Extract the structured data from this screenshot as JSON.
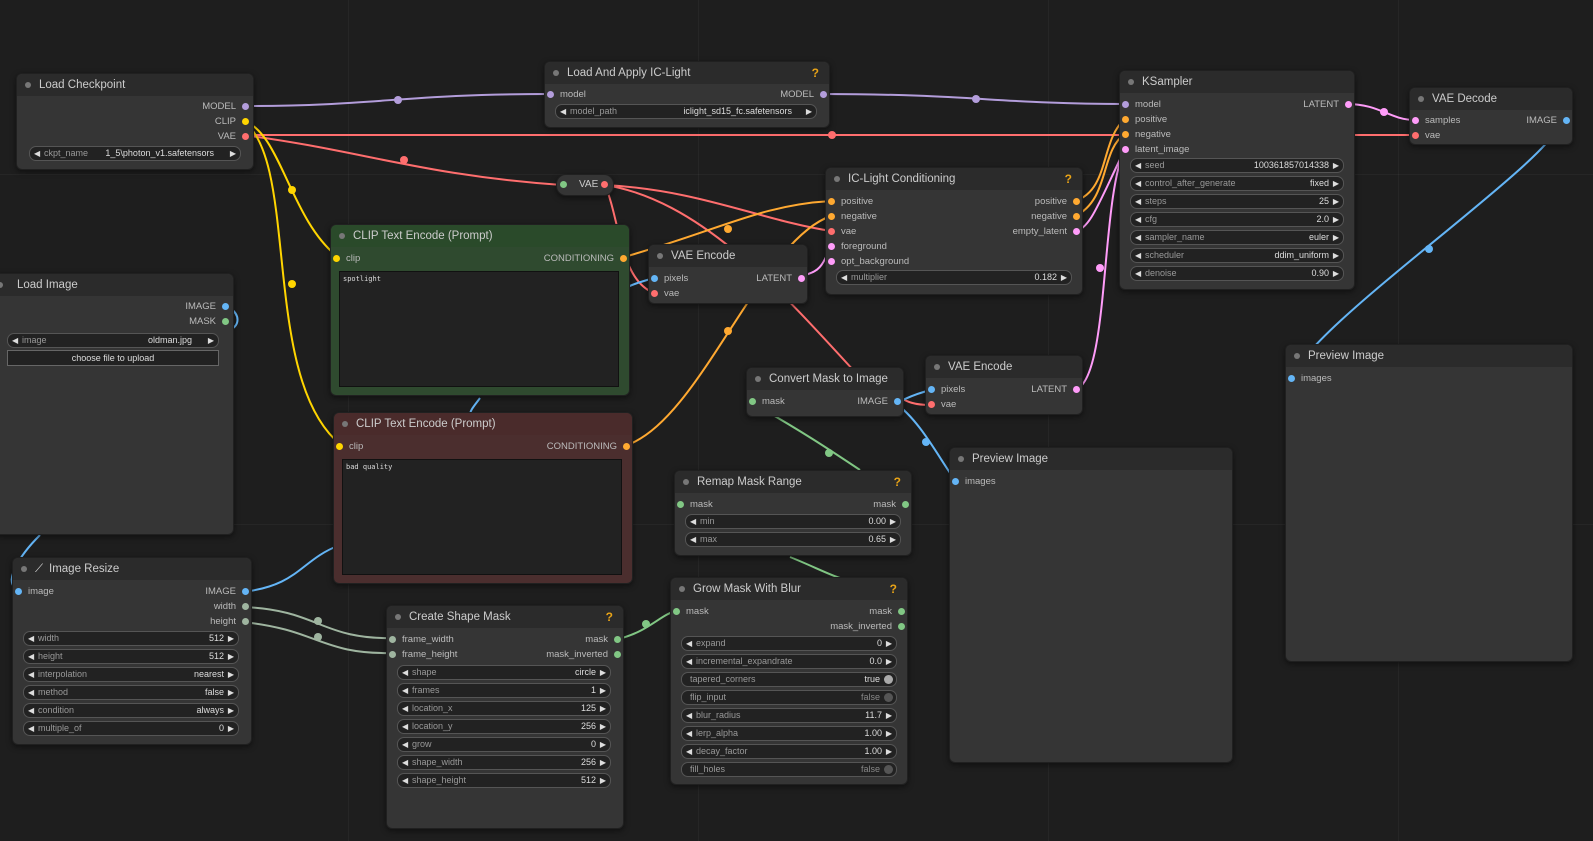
{
  "colors": {
    "model": "#b39ddb",
    "clip": "#ffd500",
    "vae": "#ff6e6e",
    "conditioning": "#ffa931",
    "latent": "#ff9cf9",
    "image": "#64b5f6",
    "mask": "#81c784",
    "int": "#9fb5a0"
  },
  "nodes": {
    "load_checkpoint": {
      "title": "Load Checkpoint",
      "out_model": "MODEL",
      "out_clip": "CLIP",
      "out_vae": "VAE",
      "ckpt_label": "ckpt_name",
      "ckpt_value": "1_5\\photon_v1.safetensors"
    },
    "ic_light": {
      "title": "Load And Apply IC-Light",
      "help": "?",
      "in_model": "model",
      "out_model": "MODEL",
      "path_label": "model_path",
      "path_value": "iclight_sd15_fc.safetensors"
    },
    "ksampler": {
      "title": "KSampler",
      "in_model": "model",
      "in_positive": "positive",
      "in_negative": "negative",
      "in_latent": "latent_image",
      "out_latent": "LATENT",
      "widgets": [
        {
          "label": "seed",
          "value": "100361857014338"
        },
        {
          "label": "control_after_generate",
          "value": "fixed"
        },
        {
          "label": "steps",
          "value": "25"
        },
        {
          "label": "cfg",
          "value": "2.0"
        },
        {
          "label": "sampler_name",
          "value": "euler"
        },
        {
          "label": "scheduler",
          "value": "ddim_uniform"
        },
        {
          "label": "denoise",
          "value": "0.90"
        }
      ]
    },
    "vae_decode": {
      "title": "VAE Decode",
      "in_samples": "samples",
      "in_vae": "vae",
      "out_image": "IMAGE"
    },
    "vae_reroute": {
      "label": "VAE"
    },
    "iclight_cond": {
      "title": "IC-Light Conditioning",
      "help": "?",
      "in_positive": "positive",
      "in_negative": "negative",
      "in_vae": "vae",
      "in_foreground": "foreground",
      "in_opt_background": "opt_background",
      "out_positive": "positive",
      "out_negative": "negative",
      "out_empty_latent": "empty_latent",
      "mult_label": "multiplier",
      "mult_value": "0.182"
    },
    "clip_pos": {
      "title": "CLIP Text Encode (Prompt)",
      "in_clip": "clip",
      "out_cond": "CONDITIONING",
      "text": "spotlight"
    },
    "clip_neg": {
      "title": "CLIP Text Encode (Prompt)",
      "in_clip": "clip",
      "out_cond": "CONDITIONING",
      "text": "bad quality"
    },
    "vae_encode_1": {
      "title": "VAE Encode",
      "in_pixels": "pixels",
      "in_vae": "vae",
      "out_latent": "LATENT"
    },
    "load_image": {
      "title": "Load Image",
      "out_image": "IMAGE",
      "out_mask": "MASK",
      "image_label": "image",
      "image_value": "oldman.jpg",
      "upload_label": "choose file to upload"
    },
    "convert_mask": {
      "title": "Convert Mask to Image",
      "in_mask": "mask",
      "out_image": "IMAGE"
    },
    "vae_encode_2": {
      "title": "VAE Encode",
      "in_pixels": "pixels",
      "in_vae": "vae",
      "out_latent": "LATENT"
    },
    "preview_1": {
      "title": "Preview Image",
      "in_images": "images"
    },
    "preview_2": {
      "title": "Preview Image",
      "in_images": "images"
    },
    "remap_mask": {
      "title": "Remap Mask Range",
      "help": "?",
      "in_mask": "mask",
      "out_mask": "mask",
      "widgets": [
        {
          "label": "min",
          "value": "0.00"
        },
        {
          "label": "max",
          "value": "0.65"
        }
      ]
    },
    "image_resize": {
      "title": "Image Resize",
      "in_image": "image",
      "out_image": "IMAGE",
      "out_width": "width",
      "out_height": "height",
      "widgets": [
        {
          "label": "width",
          "value": "512"
        },
        {
          "label": "height",
          "value": "512"
        },
        {
          "label": "interpolation",
          "value": "nearest"
        },
        {
          "label": "method",
          "value": "false"
        },
        {
          "label": "condition",
          "value": "always"
        },
        {
          "label": "multiple_of",
          "value": "0"
        }
      ]
    },
    "create_shape_mask": {
      "title": "Create Shape Mask",
      "help": "?",
      "in_frame_width": "frame_width",
      "in_frame_height": "frame_height",
      "out_mask": "mask",
      "out_mask_inverted": "mask_inverted",
      "widgets": [
        {
          "label": "shape",
          "value": "circle"
        },
        {
          "label": "frames",
          "value": "1"
        },
        {
          "label": "location_x",
          "value": "125"
        },
        {
          "label": "location_y",
          "value": "256"
        },
        {
          "label": "grow",
          "value": "0"
        },
        {
          "label": "shape_width",
          "value": "256"
        },
        {
          "label": "shape_height",
          "value": "512"
        }
      ]
    },
    "grow_mask": {
      "title": "Grow Mask With Blur",
      "help": "?",
      "in_mask": "mask",
      "out_mask": "mask",
      "out_mask_inverted": "mask_inverted",
      "widgets": [
        {
          "label": "expand",
          "value": "0"
        },
        {
          "label": "incremental_expandrate",
          "value": "0.0"
        }
      ],
      "tapered_label": "tapered_corners",
      "tapered_value": "true",
      "flip_label": "flip_input",
      "flip_value": "false",
      "widgets2": [
        {
          "label": "blur_radius",
          "value": "11.7"
        },
        {
          "label": "lerp_alpha",
          "value": "1.00"
        },
        {
          "label": "decay_factor",
          "value": "1.00"
        }
      ],
      "fill_label": "fill_holes",
      "fill_value": "false"
    }
  }
}
